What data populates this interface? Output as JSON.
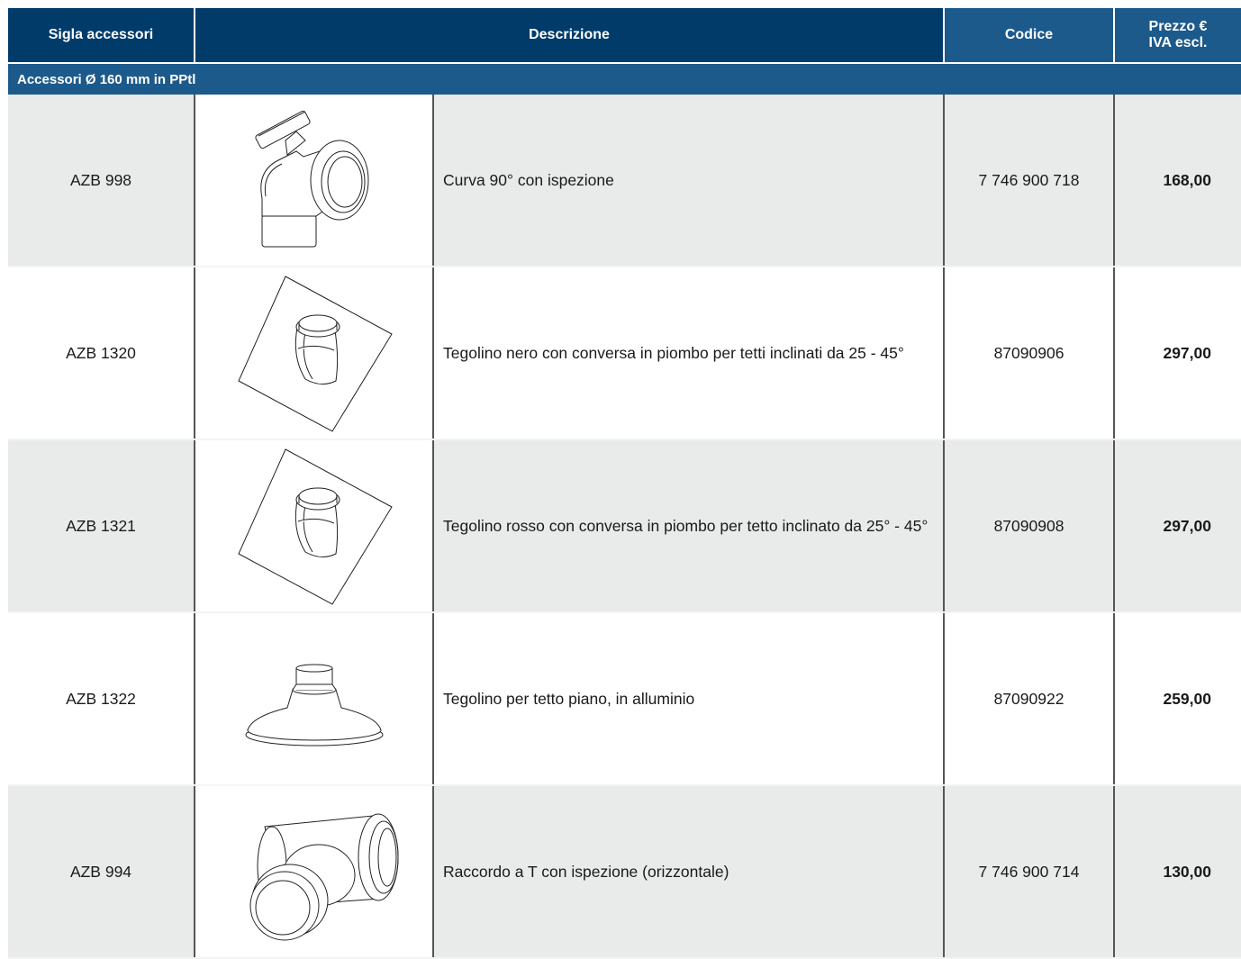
{
  "header": {
    "sigla": "Sigla accessori",
    "descrizione": "Descrizione",
    "codice": "Codice",
    "prezzo_line1": "Prezzo €",
    "prezzo_line2": "IVA escl."
  },
  "section": {
    "title": "Accessori Ø 160 mm in PPtl"
  },
  "rows": [
    {
      "sigla": "AZB 998",
      "descrizione": "Curva 90° con ispezione",
      "codice": "7 746 900 718",
      "prezzo": "168,00",
      "icon": "elbow-90-inspection-icon"
    },
    {
      "sigla": "AZB 1320",
      "descrizione": "Tegolino nero con conversa in piombo per tetti inclinati da 25 - 45°",
      "codice": "87090906",
      "prezzo": "297,00",
      "icon": "pitched-roof-flashing-icon"
    },
    {
      "sigla": "AZB 1321",
      "descrizione": "Tegolino rosso con conversa in piombo per tetto inclinato da 25° - 45°",
      "codice": "87090908",
      "prezzo": "297,00",
      "icon": "pitched-roof-flashing-icon"
    },
    {
      "sigla": "AZB 1322",
      "descrizione": "Tegolino per tetto piano, in alluminio",
      "codice": "87090922",
      "prezzo": "259,00",
      "icon": "flat-roof-flashing-icon"
    },
    {
      "sigla": "AZB 994",
      "descrizione": "Raccordo a T con ispezione (orizzontale)",
      "codice": "7 746 900 714",
      "prezzo": "130,00",
      "icon": "tee-inspection-icon"
    }
  ],
  "colors": {
    "header_dark": "#003b6a",
    "header_mid": "#1d5a8c",
    "row_shade": "#e9eaea"
  }
}
